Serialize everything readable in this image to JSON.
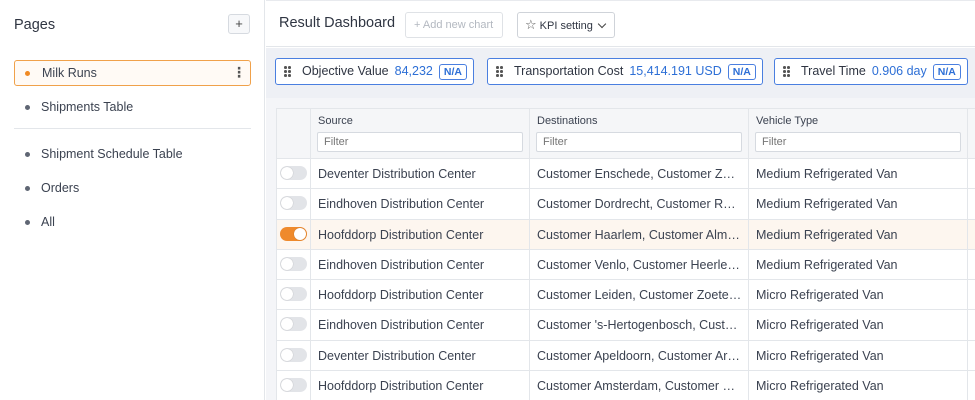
{
  "sidebar": {
    "title": "Pages",
    "add_label": "+",
    "items_group1": [
      {
        "label": "Milk Runs",
        "active": true
      },
      {
        "label": "Shipments Table",
        "active": false
      }
    ],
    "items_group2": [
      {
        "label": "Shipment Schedule Table"
      },
      {
        "label": "Orders"
      },
      {
        "label": "All"
      }
    ]
  },
  "header": {
    "title": "Result Dashboard",
    "add_chart_label": "+ Add new chart",
    "kpi_setting_label": "KPI setting"
  },
  "kpis": [
    {
      "label": "Objective Value",
      "value": "84,232",
      "badge": "N/A"
    },
    {
      "label": "Transportation Cost",
      "value": "15,414.191 USD",
      "badge": "N/A"
    },
    {
      "label": "Travel Time",
      "value": "0.906 day",
      "badge": "N/A"
    }
  ],
  "table": {
    "columns": [
      "Source",
      "Destinations",
      "Vehicle Type"
    ],
    "filter_placeholder": "Filter",
    "rows": [
      {
        "enabled": false,
        "source": "Deventer Distribution Center",
        "destinations": "Customer Enschede, Customer Zw…",
        "vehicle": "Medium Refrigerated Van"
      },
      {
        "enabled": false,
        "source": "Eindhoven Distribution Center",
        "destinations": "Customer Dordrecht, Customer Ro…",
        "vehicle": "Medium Refrigerated Van"
      },
      {
        "enabled": true,
        "source": "Hoofddorp Distribution Center",
        "destinations": "Customer Haarlem, Customer Alm…",
        "vehicle": "Medium Refrigerated Van"
      },
      {
        "enabled": false,
        "source": "Eindhoven Distribution Center",
        "destinations": "Customer Venlo, Customer Heerle…",
        "vehicle": "Medium Refrigerated Van"
      },
      {
        "enabled": false,
        "source": "Hoofddorp Distribution Center",
        "destinations": "Customer Leiden, Customer Zoeter…",
        "vehicle": "Micro Refrigerated Van"
      },
      {
        "enabled": false,
        "source": "Eindhoven Distribution Center",
        "destinations": "Customer 's-Hertogenbosch, Custo…",
        "vehicle": "Micro Refrigerated Van"
      },
      {
        "enabled": false,
        "source": "Deventer Distribution Center",
        "destinations": "Customer Apeldoorn, Customer Ar…",
        "vehicle": "Micro Refrigerated Van"
      },
      {
        "enabled": false,
        "source": "Hoofddorp Distribution Center",
        "destinations": "Customer Amsterdam, Customer Z…",
        "vehicle": "Micro Refrigerated Van"
      }
    ]
  },
  "colors": {
    "accent": "#ef8a2c",
    "kpi_blue": "#2d6fd6"
  }
}
